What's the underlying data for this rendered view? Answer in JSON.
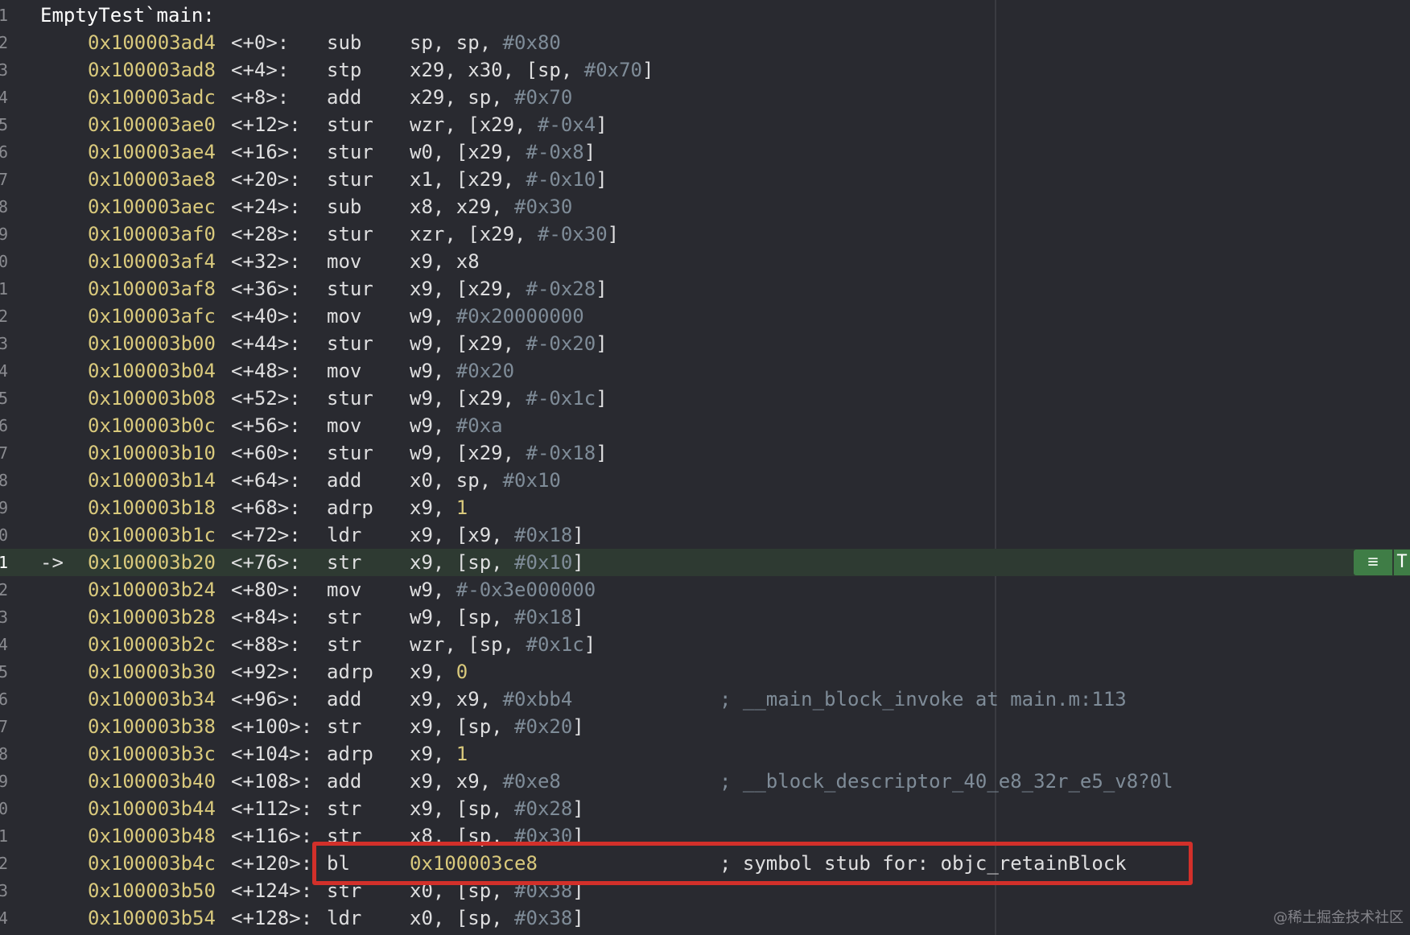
{
  "title": "EmptyTest`main:",
  "pc_arrow": "->",
  "pc_marker_icon": "≡",
  "thread_tag": "T",
  "watermark": "@稀土掘金技术社区",
  "highlight_color": "#d2302a",
  "lines": [
    {
      "n": "1"
    },
    {
      "n": "2",
      "addr": "0x100003ad4",
      "off": "<+0>:",
      "mnem": "sub",
      "ops": [
        {
          "t": "sp, sp, ",
          "c": "reg"
        },
        {
          "t": "#0x80",
          "c": "imm"
        }
      ]
    },
    {
      "n": "3",
      "addr": "0x100003ad8",
      "off": "<+4>:",
      "mnem": "stp",
      "ops": [
        {
          "t": "x29, x30, [sp, ",
          "c": "reg"
        },
        {
          "t": "#0x70",
          "c": "imm"
        },
        {
          "t": "]",
          "c": "reg"
        }
      ]
    },
    {
      "n": "4",
      "addr": "0x100003adc",
      "off": "<+8>:",
      "mnem": "add",
      "ops": [
        {
          "t": "x29, sp, ",
          "c": "reg"
        },
        {
          "t": "#0x70",
          "c": "imm"
        }
      ]
    },
    {
      "n": "5",
      "addr": "0x100003ae0",
      "off": "<+12>:",
      "mnem": "stur",
      "ops": [
        {
          "t": "wzr, [x29, ",
          "c": "reg"
        },
        {
          "t": "#-0x4",
          "c": "imm"
        },
        {
          "t": "]",
          "c": "reg"
        }
      ]
    },
    {
      "n": "6",
      "addr": "0x100003ae4",
      "off": "<+16>:",
      "mnem": "stur",
      "ops": [
        {
          "t": "w0, [x29, ",
          "c": "reg"
        },
        {
          "t": "#-0x8",
          "c": "imm"
        },
        {
          "t": "]",
          "c": "reg"
        }
      ]
    },
    {
      "n": "7",
      "addr": "0x100003ae8",
      "off": "<+20>:",
      "mnem": "stur",
      "ops": [
        {
          "t": "x1, [x29, ",
          "c": "reg"
        },
        {
          "t": "#-0x10",
          "c": "imm"
        },
        {
          "t": "]",
          "c": "reg"
        }
      ]
    },
    {
      "n": "8",
      "addr": "0x100003aec",
      "off": "<+24>:",
      "mnem": "sub",
      "ops": [
        {
          "t": "x8, x29, ",
          "c": "reg"
        },
        {
          "t": "#0x30",
          "c": "imm"
        }
      ]
    },
    {
      "n": "9",
      "addr": "0x100003af0",
      "off": "<+28>:",
      "mnem": "stur",
      "ops": [
        {
          "t": "xzr, [x29, ",
          "c": "reg"
        },
        {
          "t": "#-0x30",
          "c": "imm"
        },
        {
          "t": "]",
          "c": "reg"
        }
      ]
    },
    {
      "n": "0",
      "addr": "0x100003af4",
      "off": "<+32>:",
      "mnem": "mov",
      "ops": [
        {
          "t": "x9, x8",
          "c": "reg"
        }
      ]
    },
    {
      "n": "1",
      "addr": "0x100003af8",
      "off": "<+36>:",
      "mnem": "stur",
      "ops": [
        {
          "t": "x9, [x29, ",
          "c": "reg"
        },
        {
          "t": "#-0x28",
          "c": "imm"
        },
        {
          "t": "]",
          "c": "reg"
        }
      ]
    },
    {
      "n": "2",
      "addr": "0x100003afc",
      "off": "<+40>:",
      "mnem": "mov",
      "ops": [
        {
          "t": "w9, ",
          "c": "reg"
        },
        {
          "t": "#0x20000000",
          "c": "imm"
        }
      ]
    },
    {
      "n": "3",
      "addr": "0x100003b00",
      "off": "<+44>:",
      "mnem": "stur",
      "ops": [
        {
          "t": "w9, [x29, ",
          "c": "reg"
        },
        {
          "t": "#-0x20",
          "c": "imm"
        },
        {
          "t": "]",
          "c": "reg"
        }
      ]
    },
    {
      "n": "4",
      "addr": "0x100003b04",
      "off": "<+48>:",
      "mnem": "mov",
      "ops": [
        {
          "t": "w9, ",
          "c": "reg"
        },
        {
          "t": "#0x20",
          "c": "imm"
        }
      ]
    },
    {
      "n": "5",
      "addr": "0x100003b08",
      "off": "<+52>:",
      "mnem": "stur",
      "ops": [
        {
          "t": "w9, [x29, ",
          "c": "reg"
        },
        {
          "t": "#-0x1c",
          "c": "imm"
        },
        {
          "t": "]",
          "c": "reg"
        }
      ]
    },
    {
      "n": "6",
      "addr": "0x100003b0c",
      "off": "<+56>:",
      "mnem": "mov",
      "ops": [
        {
          "t": "w9, ",
          "c": "reg"
        },
        {
          "t": "#0xa",
          "c": "imm"
        }
      ]
    },
    {
      "n": "7",
      "addr": "0x100003b10",
      "off": "<+60>:",
      "mnem": "stur",
      "ops": [
        {
          "t": "w9, [x29, ",
          "c": "reg"
        },
        {
          "t": "#-0x18",
          "c": "imm"
        },
        {
          "t": "]",
          "c": "reg"
        }
      ]
    },
    {
      "n": "8",
      "addr": "0x100003b14",
      "off": "<+64>:",
      "mnem": "add",
      "ops": [
        {
          "t": "x0, sp, ",
          "c": "reg"
        },
        {
          "t": "#0x10",
          "c": "imm"
        }
      ]
    },
    {
      "n": "9",
      "addr": "0x100003b18",
      "off": "<+68>:",
      "mnem": "adrp",
      "ops": [
        {
          "t": "x9, ",
          "c": "reg"
        },
        {
          "t": "1",
          "c": "num"
        }
      ]
    },
    {
      "n": "0",
      "addr": "0x100003b1c",
      "off": "<+72>:",
      "mnem": "ldr",
      "ops": [
        {
          "t": "x9, [x9, ",
          "c": "reg"
        },
        {
          "t": "#0x18",
          "c": "imm"
        },
        {
          "t": "]",
          "c": "reg"
        }
      ]
    },
    {
      "n": "1",
      "current": true,
      "addr": "0x100003b20",
      "off": "<+76>:",
      "mnem": "str",
      "ops": [
        {
          "t": "x9, [sp, ",
          "c": "reg"
        },
        {
          "t": "#0x10",
          "c": "imm"
        },
        {
          "t": "]",
          "c": "reg"
        }
      ]
    },
    {
      "n": "2",
      "addr": "0x100003b24",
      "off": "<+80>:",
      "mnem": "mov",
      "ops": [
        {
          "t": "w9, ",
          "c": "reg"
        },
        {
          "t": "#-0x3e000000",
          "c": "imm"
        }
      ]
    },
    {
      "n": "3",
      "addr": "0x100003b28",
      "off": "<+84>:",
      "mnem": "str",
      "ops": [
        {
          "t": "w9, [sp, ",
          "c": "reg"
        },
        {
          "t": "#0x18",
          "c": "imm"
        },
        {
          "t": "]",
          "c": "reg"
        }
      ]
    },
    {
      "n": "4",
      "addr": "0x100003b2c",
      "off": "<+88>:",
      "mnem": "str",
      "ops": [
        {
          "t": "wzr, [sp, ",
          "c": "reg"
        },
        {
          "t": "#0x1c",
          "c": "imm"
        },
        {
          "t": "]",
          "c": "reg"
        }
      ]
    },
    {
      "n": "5",
      "addr": "0x100003b30",
      "off": "<+92>:",
      "mnem": "adrp",
      "ops": [
        {
          "t": "x9, ",
          "c": "reg"
        },
        {
          "t": "0",
          "c": "num"
        }
      ]
    },
    {
      "n": "6",
      "addr": "0x100003b34",
      "off": "<+96>:",
      "mnem": "add",
      "ops": [
        {
          "t": "x9, x9, ",
          "c": "reg"
        },
        {
          "t": "#0xbb4",
          "c": "imm"
        }
      ],
      "comment": "; __main_block_invoke at main.m:113"
    },
    {
      "n": "7",
      "addr": "0x100003b38",
      "off": "<+100>:",
      "mnem": "str",
      "ops": [
        {
          "t": "x9, [sp, ",
          "c": "reg"
        },
        {
          "t": "#0x20",
          "c": "imm"
        },
        {
          "t": "]",
          "c": "reg"
        }
      ]
    },
    {
      "n": "8",
      "addr": "0x100003b3c",
      "off": "<+104>:",
      "mnem": "adrp",
      "ops": [
        {
          "t": "x9, ",
          "c": "reg"
        },
        {
          "t": "1",
          "c": "num"
        }
      ]
    },
    {
      "n": "9",
      "addr": "0x100003b40",
      "off": "<+108>:",
      "mnem": "add",
      "ops": [
        {
          "t": "x9, x9, ",
          "c": "reg"
        },
        {
          "t": "#0xe8",
          "c": "imm"
        }
      ],
      "comment": "; __block_descriptor_40_e8_32r_e5_v8?0l"
    },
    {
      "n": "0",
      "addr": "0x100003b44",
      "off": "<+112>:",
      "mnem": "str",
      "ops": [
        {
          "t": "x9, [sp, ",
          "c": "reg"
        },
        {
          "t": "#0x28",
          "c": "imm"
        },
        {
          "t": "]",
          "c": "reg"
        }
      ]
    },
    {
      "n": "1",
      "addr": "0x100003b48",
      "off": "<+116>:",
      "mnem": "str",
      "ops": [
        {
          "t": "x8, [sp, ",
          "c": "reg"
        },
        {
          "t": "#0x30",
          "c": "imm"
        },
        {
          "t": "]",
          "c": "reg"
        }
      ]
    },
    {
      "n": "2",
      "addr": "0x100003b4c",
      "off": "<+120>:",
      "mnem": "bl",
      "ops": [
        {
          "t": "0x100003ce8",
          "c": "addrop"
        }
      ],
      "comment": "; symbol stub for: objc_retainBlock",
      "comment_bright": true
    },
    {
      "n": "3",
      "addr": "0x100003b50",
      "off": "<+124>:",
      "mnem": "str",
      "ops": [
        {
          "t": "x0, [sp, ",
          "c": "reg"
        },
        {
          "t": "#0x38",
          "c": "imm"
        },
        {
          "t": "]",
          "c": "reg"
        }
      ]
    },
    {
      "n": "4",
      "addr": "0x100003b54",
      "off": "<+128>:",
      "mnem": "ldr",
      "ops": [
        {
          "t": "x0, [sp, ",
          "c": "reg"
        },
        {
          "t": "#0x38",
          "c": "imm"
        },
        {
          "t": "]",
          "c": "reg"
        }
      ]
    }
  ]
}
